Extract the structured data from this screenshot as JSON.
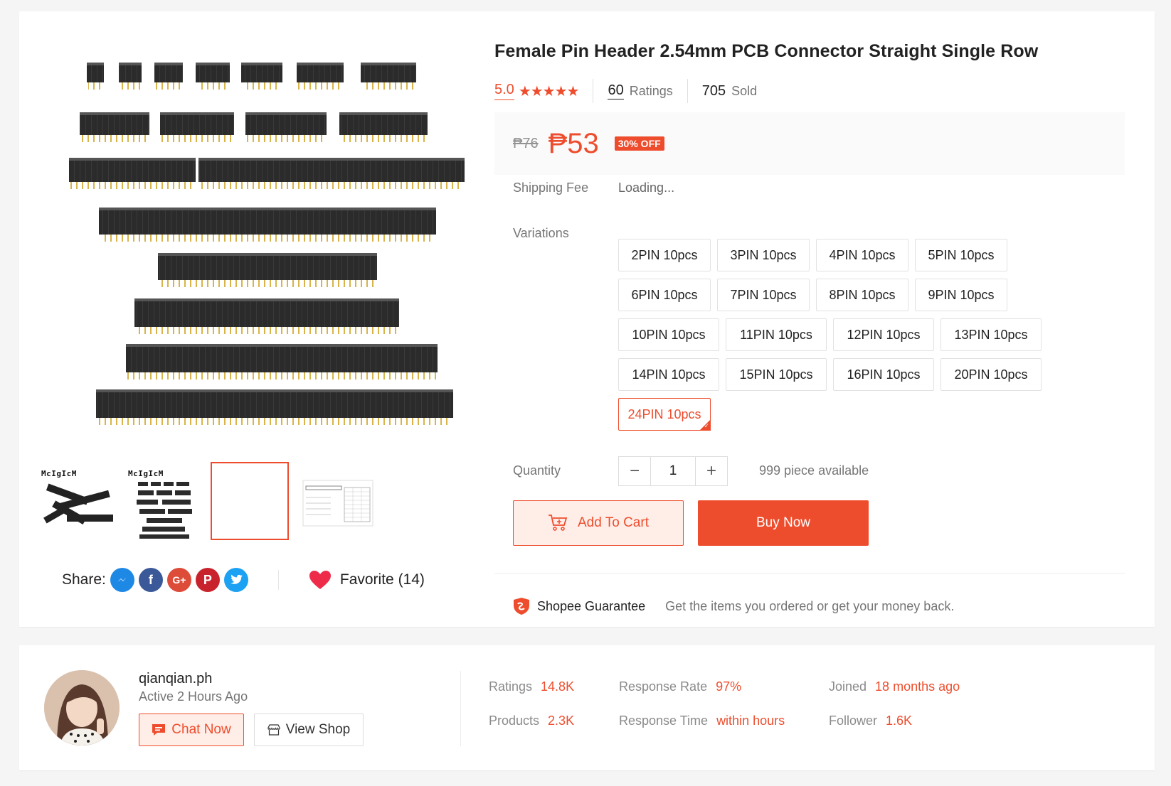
{
  "product": {
    "title": "Female Pin Header 2.54mm PCB Connector Straight Single Row",
    "rating": "5.0",
    "stars": "★★★★★",
    "ratings_count": "60",
    "ratings_label": "Ratings",
    "sold_count": "705",
    "sold_label": "Sold",
    "old_price": "₱76",
    "new_price": "₱53",
    "discount": "30% OFF",
    "shipping_label": "Shipping Fee",
    "shipping_value": "Loading...",
    "variations_label": "Variations",
    "variations": [
      "2PIN 10pcs",
      "3PIN 10pcs",
      "4PIN 10pcs",
      "5PIN 10pcs",
      "6PIN 10pcs",
      "7PIN 10pcs",
      "8PIN 10pcs",
      "9PIN 10pcs",
      "10PIN 10pcs",
      "11PIN 10pcs",
      "12PIN 10pcs",
      "13PIN 10pcs",
      "14PIN 10pcs",
      "15PIN 10pcs",
      "16PIN 10pcs",
      "20PIN 10pcs",
      "24PIN 10pcs"
    ],
    "selected_variation": "24PIN 10pcs",
    "quantity_label": "Quantity",
    "quantity": "1",
    "qty_minus": "−",
    "qty_plus": "+",
    "available": "999 piece available",
    "add_to_cart": "Add To Cart",
    "buy_now": "Buy Now",
    "guarantee_title": "Shopee Guarantee",
    "guarantee_text": "Get the items you ordered or get your money back."
  },
  "gallery": {
    "thumb_brand_text": "McIgIcM"
  },
  "share": {
    "label": "Share:",
    "icons": [
      "messenger-icon",
      "facebook-icon",
      "google-plus-icon",
      "pinterest-icon",
      "twitter-icon"
    ],
    "favorite": "Favorite (14)"
  },
  "shop": {
    "name": "qianqian.ph",
    "active": "Active 2 Hours Ago",
    "chat": "Chat Now",
    "view": "View Shop",
    "stats": {
      "ratings_label": "Ratings",
      "ratings_value": "14.8K",
      "products_label": "Products",
      "products_value": "2.3K",
      "response_rate_label": "Response Rate",
      "response_rate_value": "97%",
      "response_time_label": "Response Time",
      "response_time_value": "within hours",
      "joined_label": "Joined",
      "joined_value": "18 months ago",
      "follower_label": "Follower",
      "follower_value": "1.6K"
    }
  },
  "colors": {
    "accent": "#ee4d2d",
    "background": "#f5f5f5",
    "price_bg": "#fafafa"
  }
}
